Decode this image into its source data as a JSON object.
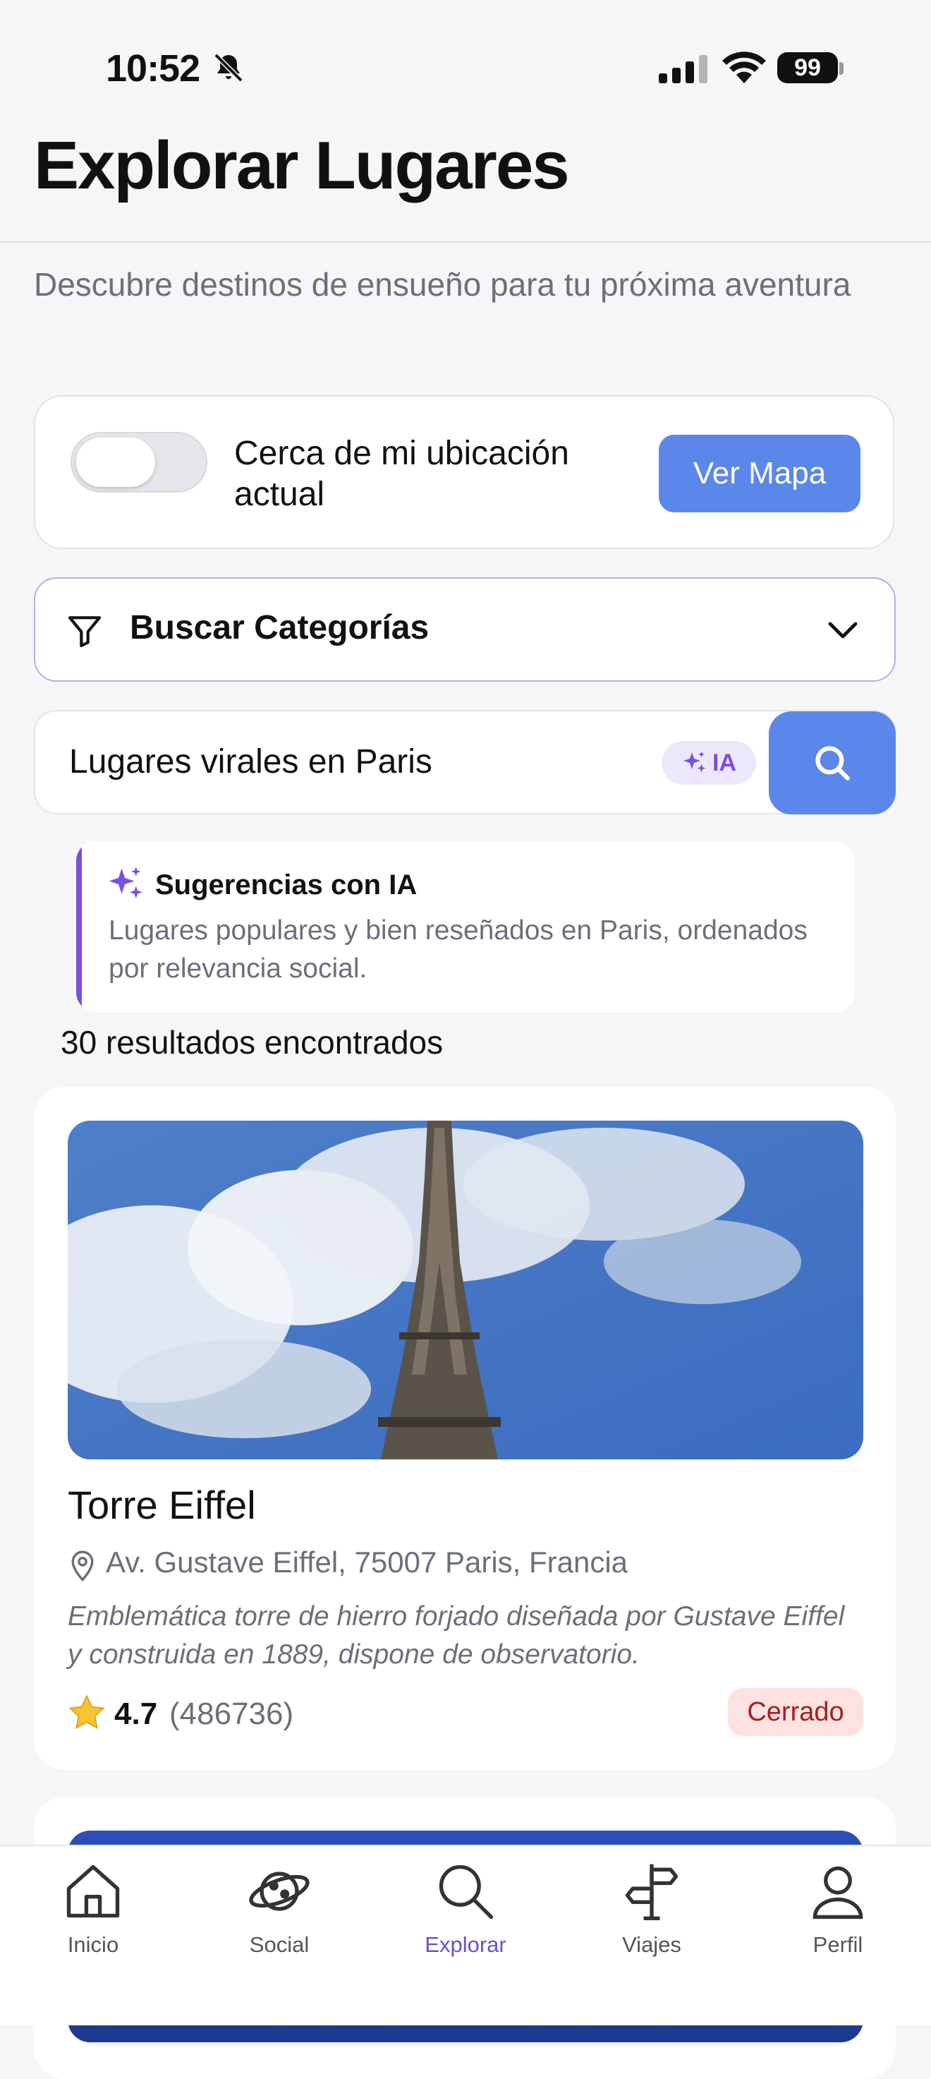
{
  "status_bar": {
    "time": "10:52",
    "battery": "99"
  },
  "header": {
    "title": "Explorar Lugares",
    "subtitle": "Descubre destinos de ensueño para tu próxima aventura"
  },
  "location": {
    "label": "Cerca de mi ubicación actual",
    "toggle_on": false,
    "map_button": "Ver Mapa"
  },
  "categories": {
    "label": "Buscar Categorías"
  },
  "search": {
    "value": "Lugares virales en Paris",
    "ai_badge": "IA"
  },
  "ai_suggestion": {
    "title": "Sugerencias con IA",
    "body": "Lugares populares y bien reseñados en Paris, ordenados por relevancia social."
  },
  "results": {
    "count_text": "30 resultados encontrados"
  },
  "places": [
    {
      "name": "Torre Eiffel",
      "address": "Av. Gustave Eiffel, 75007 Paris, Francia",
      "description": "Emblemática torre de hierro forjado diseñada por Gustave Eiffel y construida en 1889, dispone de observatorio.",
      "rating": "4.7",
      "reviews": "(486736)",
      "status": "Cerrado"
    }
  ],
  "tabbar": {
    "items": [
      {
        "label": "Inicio",
        "icon": "home-icon"
      },
      {
        "label": "Social",
        "icon": "planet-icon"
      },
      {
        "label": "Explorar",
        "icon": "search-icon",
        "active": true
      },
      {
        "label": "Viajes",
        "icon": "signpost-icon"
      },
      {
        "label": "Perfil",
        "icon": "user-icon"
      }
    ]
  },
  "colors": {
    "accent": "#5b87ea",
    "ai_purple": "#7c4fe0",
    "active_tab": "#6a4fd0",
    "closed_badge": "#fde2e2"
  }
}
